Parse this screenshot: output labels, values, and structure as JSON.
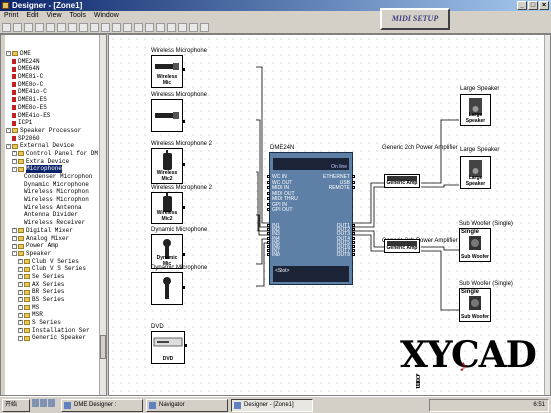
{
  "window": {
    "title": "Designer - [Zone1]"
  },
  "menu": [
    "Print",
    "Edit",
    "View",
    "Tools",
    "Window"
  ],
  "toolbar": {
    "midi_setup": "MIDI SETUP"
  },
  "tree": [
    {
      "indent": 1,
      "toggle": "-",
      "kind": "root",
      "label": "DME"
    },
    {
      "indent": 2,
      "kind": "node",
      "label": "DME24N"
    },
    {
      "indent": 2,
      "kind": "node",
      "label": "DME64N"
    },
    {
      "indent": 2,
      "kind": "node",
      "label": "DME8i-C"
    },
    {
      "indent": 2,
      "kind": "node",
      "label": "DME8o-C"
    },
    {
      "indent": 2,
      "kind": "node",
      "label": "DME4io-C"
    },
    {
      "indent": 2,
      "kind": "node",
      "label": "DME8i-ES"
    },
    {
      "indent": 2,
      "kind": "node",
      "label": "DME8o-ES"
    },
    {
      "indent": 2,
      "kind": "node",
      "label": "DME4io-ES"
    },
    {
      "indent": 2,
      "kind": "node",
      "label": "ICP1"
    },
    {
      "indent": 1,
      "toggle": "-",
      "kind": "folder",
      "label": "Speaker Processor"
    },
    {
      "indent": 2,
      "kind": "node",
      "label": "SP2060"
    },
    {
      "indent": 1,
      "toggle": "-",
      "kind": "folder",
      "label": "External Device"
    },
    {
      "indent": 2,
      "toggle": "+",
      "kind": "folder",
      "label": "Control Panel for DM"
    },
    {
      "indent": 2,
      "toggle": "+",
      "kind": "folder",
      "label": "Extra Device"
    },
    {
      "indent": 2,
      "toggle": "-",
      "kind": "folder",
      "label": "Microphone",
      "selected": true
    },
    {
      "indent": 3,
      "kind": "leaf",
      "label": "Condenser Microphon"
    },
    {
      "indent": 3,
      "kind": "leaf",
      "label": "Dynamic Microphone"
    },
    {
      "indent": 3,
      "kind": "leaf",
      "label": "Wireless Microphon"
    },
    {
      "indent": 3,
      "kind": "leaf",
      "label": "Wireless Microphon"
    },
    {
      "indent": 3,
      "kind": "leaf",
      "label": "Wireless Antenna"
    },
    {
      "indent": 3,
      "kind": "leaf",
      "label": "Antenna Divider"
    },
    {
      "indent": 3,
      "kind": "leaf",
      "label": "Wireless Receiver"
    },
    {
      "indent": 2,
      "toggle": "+",
      "kind": "folder",
      "label": "Digital Mixer"
    },
    {
      "indent": 2,
      "toggle": "+",
      "kind": "folder",
      "label": "Analog Mixer"
    },
    {
      "indent": 2,
      "toggle": "+",
      "kind": "folder",
      "label": "Power Amp"
    },
    {
      "indent": 2,
      "toggle": "-",
      "kind": "folder",
      "label": "Speaker"
    },
    {
      "indent": 3,
      "toggle": "+",
      "kind": "folder",
      "label": "Club V Series"
    },
    {
      "indent": 3,
      "toggle": "+",
      "kind": "folder",
      "label": "Club V S Series"
    },
    {
      "indent": 3,
      "toggle": "+",
      "kind": "folder",
      "label": "Se Series"
    },
    {
      "indent": 3,
      "toggle": "+",
      "kind": "folder",
      "label": "AX Series"
    },
    {
      "indent": 3,
      "toggle": "+",
      "kind": "folder",
      "label": "BR Series"
    },
    {
      "indent": 3,
      "toggle": "+",
      "kind": "folder",
      "label": "BS Series"
    },
    {
      "indent": 3,
      "toggle": "+",
      "kind": "folder",
      "label": "MS"
    },
    {
      "indent": 3,
      "toggle": "+",
      "kind": "folder",
      "label": "MSR"
    },
    {
      "indent": 3,
      "toggle": "+",
      "kind": "folder",
      "label": "S Series"
    },
    {
      "indent": 3,
      "toggle": "+",
      "kind": "folder",
      "label": "Installation Ser"
    },
    {
      "indent": 3,
      "toggle": "+",
      "kind": "folder",
      "label": "Generic Speaker"
    }
  ],
  "devices": {
    "mic1": {
      "title": "Wireless Microphone",
      "caption": "Wireless Mic"
    },
    "mic2": {
      "title": "Wireless Microphone",
      "caption": ""
    },
    "mic3": {
      "title": "Wireless Microphone 2",
      "caption": "Wireless Mic2"
    },
    "mic4": {
      "title": "Wireless Microphone 2",
      "caption": "Wireless Mic2"
    },
    "mic5": {
      "title": "Dynamic Microphone",
      "caption": "Dynamic Mic"
    },
    "mic6": {
      "title": "Dynamic Microphone",
      "caption": ""
    },
    "dvd": {
      "title": "DVD",
      "caption": "DVD"
    },
    "amp1": {
      "title": "Generic 2ch Power Amplifier",
      "caption": "Generic Amp"
    },
    "amp2": {
      "title": "Generic 2ch Power Amplifier",
      "caption": "Generic Amp"
    },
    "spk1": {
      "title": "Large Speaker",
      "caption": "Large Speaker"
    },
    "spk2": {
      "title": "Large Speaker",
      "caption": "Large Speaker"
    },
    "sub1": {
      "title": "Sub Woofer (Single)",
      "top": "Single",
      "caption": "Sub Woofer"
    },
    "sub2": {
      "title": "Sub Woofer (Single)",
      "top": "Single",
      "caption": "Sub Woofer"
    }
  },
  "dme": {
    "title": "DME24N",
    "top_label": "On line",
    "ports_left": [
      "WC IN",
      "WC OUT",
      "MIDI IN",
      "MIDI OUT",
      "MIDI THRU",
      "GPI IN",
      "GPI OUT"
    ],
    "ports_right": [
      "ETHERNET",
      "USB",
      "REMOTE"
    ],
    "inputs": [
      "IN1",
      "IN2",
      "IN3",
      "IN4",
      "IN5",
      "IN6",
      "IN7",
      "IN8"
    ],
    "outputs": [
      "OUT1",
      "OUT2",
      "OUT3",
      "OUT4",
      "OUT5",
      "OUT6",
      "OUT7",
      "OUT8"
    ],
    "slot": "<Slot>"
  },
  "watermark": {
    "text": "XYCAD",
    "suffix": ".com"
  },
  "taskbar": {
    "start": "开始",
    "tasks": [
      "DME Designer :",
      "Navigator",
      "Designer - [Zone1]"
    ],
    "active_task": 2,
    "clock": "6:51"
  },
  "colors": {
    "dme_body": "#5e7fa6",
    "title_bar": "#0a246a",
    "canvas": "#ffffff"
  }
}
